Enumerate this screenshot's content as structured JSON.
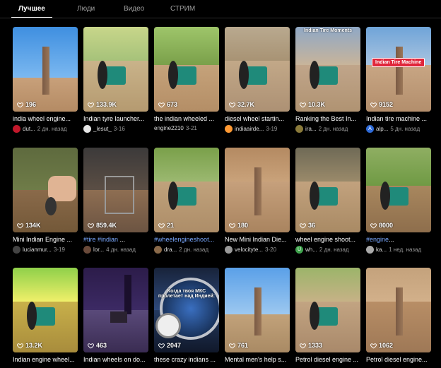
{
  "tabs": [
    {
      "label": "Лучшее",
      "active": true
    },
    {
      "label": "Люди",
      "active": false
    },
    {
      "label": "Видео",
      "active": false
    },
    {
      "label": "СТРИМ",
      "active": false
    }
  ],
  "rows": [
    [
      {
        "likes": "196",
        "title": "india wheel engine...",
        "author": "dut...",
        "date": "2 дн. назад",
        "avatar_color": "#c2182b"
      },
      {
        "likes": "133.9K",
        "title": "Indian tyre launcher...",
        "author": "_lesut_",
        "date": "3-16",
        "avatar_color": "#e6e6e6"
      },
      {
        "likes": "673",
        "title": "the indian wheeled ...",
        "author": "engine2210",
        "date": "3-21",
        "avatar_color": ""
      },
      {
        "likes": "32.7K",
        "title": "diesel wheel startin...",
        "author": "indiaairde...",
        "date": "3-19",
        "avatar_color": "#ff9933"
      },
      {
        "likes": "10.3K",
        "title": "Ranking the Best In...",
        "author": "ira...",
        "date": "2 дн. назад",
        "avatar_color": "#8a7a3a",
        "overlay": "Indian Tire Moments"
      },
      {
        "likes": "9152",
        "title": "Indian tire machine ...",
        "author": "alp...",
        "date": "5 дн. назад",
        "avatar_color": "#2f6bd8",
        "avatar_letter": "A",
        "label": "Indian Tire Machine"
      }
    ],
    [
      {
        "likes": "134K",
        "title": "Mini Indian Engine ...",
        "author": "lucianmur...",
        "date": "3-19",
        "avatar_color": "#444"
      },
      {
        "likes": "859.4K",
        "title_tag": "#tire #indian",
        "title": " ...",
        "author": "lor...",
        "date": "4 дн. назад",
        "avatar_color": "#6a4a3a"
      },
      {
        "likes": "21",
        "title_tag": "#wheelengineshoot...",
        "title": "",
        "author": "dra...",
        "date": "2 дн. назад",
        "avatar_color": "#8a6a4a"
      },
      {
        "likes": "180",
        "title": "New Mini Indian Die...",
        "author": "velocityte...",
        "date": "3-20",
        "avatar_color": "#9a9a9a"
      },
      {
        "likes": "36",
        "title": "wheel engine shoot...",
        "author": "wh...",
        "date": "2 дн. назад",
        "avatar_color": "#3fa34d",
        "avatar_letter": "U"
      },
      {
        "likes": "8000",
        "title_tag": "#engine",
        "title": "...",
        "author": "ka...",
        "date": "1 нед. назад",
        "avatar_color": "#aaa"
      }
    ],
    [
      {
        "likes": "13.2K",
        "title": "Indian engine wheel...",
        "author": "",
        "date": "",
        "avatar_color": ""
      },
      {
        "likes": "463",
        "title": "Indian wheels on do...",
        "author": "",
        "date": "",
        "avatar_color": ""
      },
      {
        "likes": "2047",
        "title": "these crazy indians ...",
        "author": "",
        "date": "",
        "avatar_color": "",
        "overlay": "Когда твоя МКС пролетает над Индией:"
      },
      {
        "likes": "761",
        "title": "Mental men's help s...",
        "author": "",
        "date": "",
        "avatar_color": ""
      },
      {
        "likes": "1333",
        "title": "Petrol diesel engine ...",
        "author": "",
        "date": "",
        "avatar_color": ""
      },
      {
        "likes": "1062",
        "title": "Petrol diesel engine...",
        "author": "",
        "date": "",
        "avatar_color": ""
      }
    ]
  ]
}
